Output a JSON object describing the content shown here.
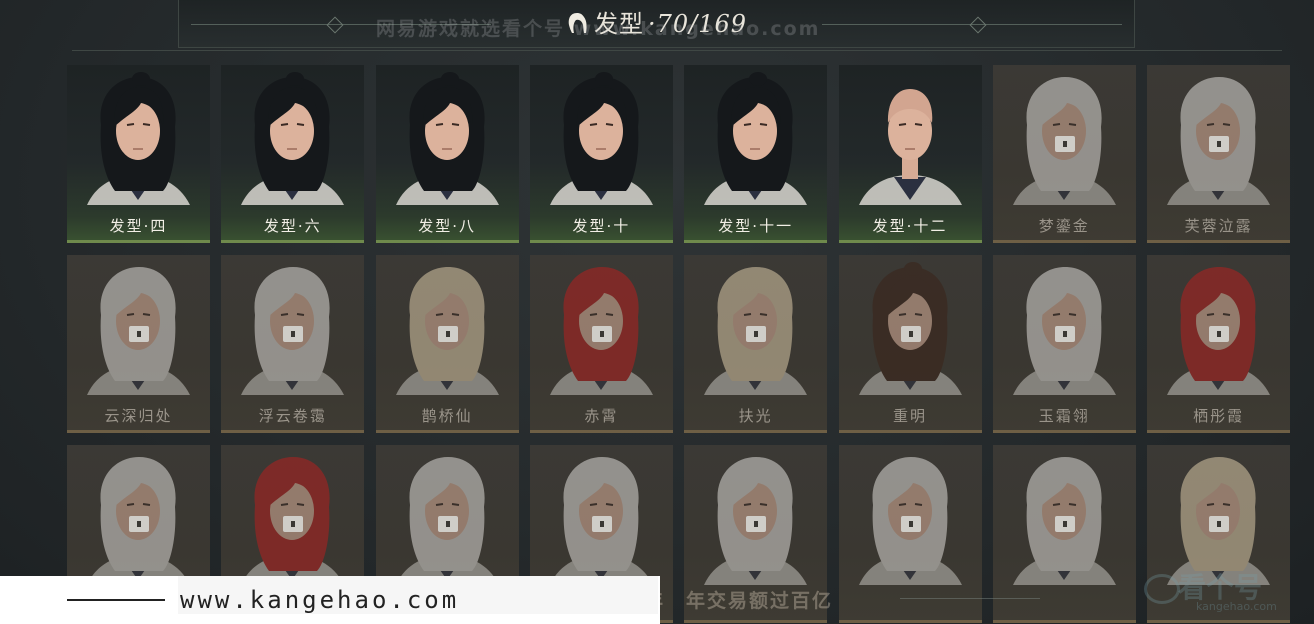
{
  "header": {
    "title": "发型",
    "count": "·70/169",
    "icon": "hair-icon",
    "watermark": "网易游戏就选看个号 www.kangehao.com"
  },
  "colors": {
    "owned_bar": "#6f8a4c",
    "locked_bar": "#6e5f45",
    "red_hair": "#b4201f",
    "white_hair": "#dcdad6"
  },
  "rows": [
    [
      {
        "name": "发型·四",
        "owned": true,
        "hair": "black"
      },
      {
        "name": "发型·六",
        "owned": true,
        "hair": "black"
      },
      {
        "name": "发型·八",
        "owned": true,
        "hair": "black"
      },
      {
        "name": "发型·十",
        "owned": true,
        "hair": "black"
      },
      {
        "name": "发型·十一",
        "owned": true,
        "hair": "black"
      },
      {
        "name": "发型·十二",
        "owned": true,
        "hair": "bald"
      },
      {
        "name": "梦鎏金",
        "owned": false,
        "hair": "white"
      },
      {
        "name": "芙蓉泣露",
        "owned": false,
        "hair": "white"
      }
    ],
    [
      {
        "name": "云深归处",
        "owned": false,
        "hair": "white"
      },
      {
        "name": "浮云卷霭",
        "owned": false,
        "hair": "white"
      },
      {
        "name": "鹊桥仙",
        "owned": false,
        "hair": "blond"
      },
      {
        "name": "赤霄",
        "owned": false,
        "hair": "red"
      },
      {
        "name": "扶光",
        "owned": false,
        "hair": "blond"
      },
      {
        "name": "重明",
        "owned": false,
        "hair": "brown"
      },
      {
        "name": "玉霜翎",
        "owned": false,
        "hair": "white"
      },
      {
        "name": "栖彤霞",
        "owned": false,
        "hair": "red"
      }
    ],
    [
      {
        "name": "",
        "owned": false,
        "hair": "white"
      },
      {
        "name": "",
        "owned": false,
        "hair": "red"
      },
      {
        "name": "",
        "owned": false,
        "hair": "white"
      },
      {
        "name": "",
        "owned": false,
        "hair": "white"
      },
      {
        "name": "",
        "owned": false,
        "hair": "white"
      },
      {
        "name": "",
        "owned": false,
        "hair": "white"
      },
      {
        "name": "",
        "owned": false,
        "hair": "white"
      },
      {
        "name": "",
        "owned": false,
        "hair": "blond"
      }
    ]
  ],
  "watermark": {
    "site": "www.kangehao.com",
    "slogan": "看个号专业网易游戏八年　年交易额过百亿",
    "logo": "看个号",
    "logo_small": "kangehao.com"
  }
}
